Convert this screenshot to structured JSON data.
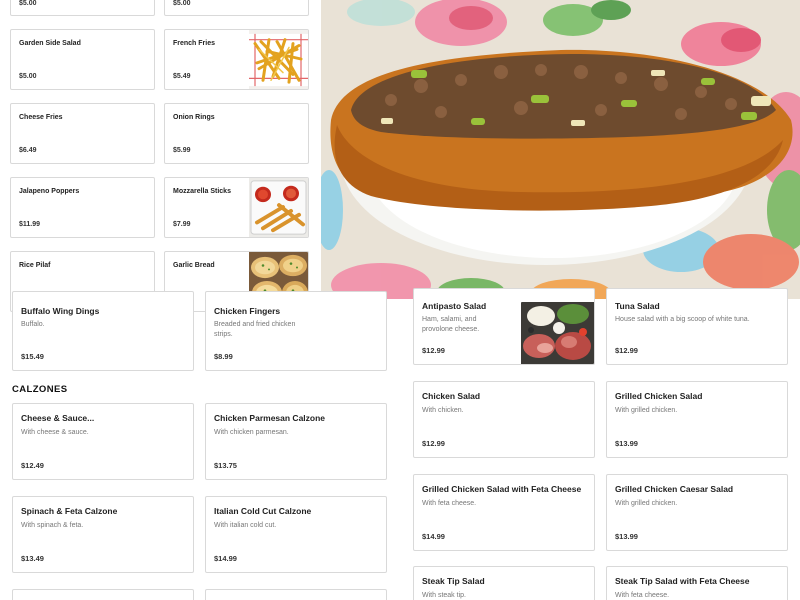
{
  "left_panel": {
    "items": [
      {
        "name": "",
        "price": "$5.00"
      },
      {
        "name": "",
        "price": "$5.00"
      },
      {
        "name": "Garden Side Salad",
        "price": "$5.00"
      },
      {
        "name": "French Fries",
        "price": "$5.49"
      },
      {
        "name": "Cheese Fries",
        "price": "$6.49"
      },
      {
        "name": "Onion Rings",
        "price": "$5.99"
      },
      {
        "name": "Jalapeno Poppers",
        "price": "$11.99"
      },
      {
        "name": "Mozzarella Sticks",
        "price": "$7.99"
      },
      {
        "name": "Rice Pilaf",
        "price": ""
      },
      {
        "name": "Garlic Bread",
        "price": ""
      }
    ]
  },
  "appetizers": [
    {
      "name": "Buffalo Wing Dings",
      "desc": "Buffalo.",
      "price": "$15.49"
    },
    {
      "name": "Chicken Fingers",
      "desc": "Breaded and fried chicken strips.",
      "price": "$8.99"
    }
  ],
  "calzones": {
    "title": "CALZONES",
    "items": [
      {
        "name": "Cheese & Sauce...",
        "desc": "With cheese & sauce.",
        "price": "$12.49"
      },
      {
        "name": "Chicken Parmesan Calzone",
        "desc": "With chicken parmesan.",
        "price": "$13.75"
      },
      {
        "name": "Spinach & Feta Calzone",
        "desc": "With spinach & feta.",
        "price": "$13.49"
      },
      {
        "name": "Italian Cold Cut Calzone",
        "desc": "With italian cold cut.",
        "price": "$14.99"
      }
    ]
  },
  "salads": [
    {
      "name": "Antipasto Salad",
      "desc": "Ham, salami, and provolone cheese.",
      "price": "$12.99"
    },
    {
      "name": "Tuna Salad",
      "desc": "House salad with a big scoop of white tuna.",
      "price": "$12.99"
    },
    {
      "name": "Chicken Salad",
      "desc": "With chicken.",
      "price": "$12.99"
    },
    {
      "name": "Grilled Chicken Salad",
      "desc": "With grilled chicken.",
      "price": "$13.99"
    },
    {
      "name": "Grilled Chicken Salad with Feta Cheese",
      "desc": "With feta cheese.",
      "price": "$14.99"
    },
    {
      "name": "Grilled Chicken Caesar Salad",
      "desc": "With grilled chicken.",
      "price": "$13.99"
    },
    {
      "name": "Steak Tip Salad",
      "desc": "With steak tip.",
      "price": ""
    },
    {
      "name": "Steak Tip Salad with Feta Cheese",
      "desc": "With feta cheese.",
      "price": ""
    }
  ],
  "colors": {
    "border": "#d9d9d9",
    "text": "#222222",
    "muted": "#777777"
  }
}
